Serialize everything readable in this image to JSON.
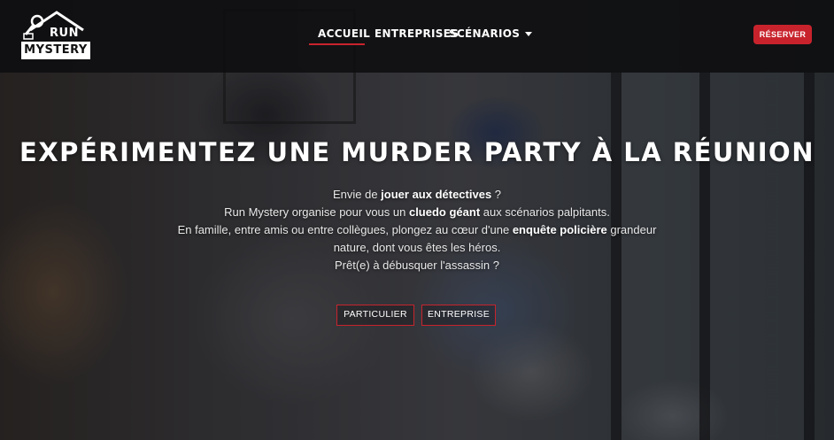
{
  "brand": {
    "logo_top": "RUN",
    "logo_bottom": "MYSTERY"
  },
  "nav": {
    "items": [
      {
        "label": "ACCUEIL",
        "active": true
      },
      {
        "label": "ENTREPRISES",
        "active": false
      },
      {
        "label": "SCÉNARIOS",
        "active": false,
        "has_dropdown": true
      }
    ],
    "reserve_label": "RÉSERVER"
  },
  "hero": {
    "title": "EXPÉRIMENTEZ UNE MURDER PARTY À LA RÉUNION",
    "line1_a": "Envie de ",
    "line1_b": "jouer aux détectives",
    "line1_c": " ?",
    "line2_a": "Run Mystery organise pour vous un ",
    "line2_b": "cluedo géant",
    "line2_c": " aux scénarios palpitants.",
    "line3_a": "En famille, entre amis ou entre collègues, plongez au cœur d'une ",
    "line3_b": "enquête policière",
    "line3_c": " grandeur",
    "line4": "nature, dont vous êtes les héros.",
    "line5": "Prêt(e) à débusquer l'assassin ?",
    "cta_particulier": "PARTICULIER",
    "cta_entreprise": "ENTREPRISE"
  },
  "colors": {
    "accent": "#c8232c",
    "header_bg": "#0e0e10"
  },
  "icons": {
    "dropdown": "chevron-down-icon",
    "logo": "magnifying-glass-house-icon"
  }
}
